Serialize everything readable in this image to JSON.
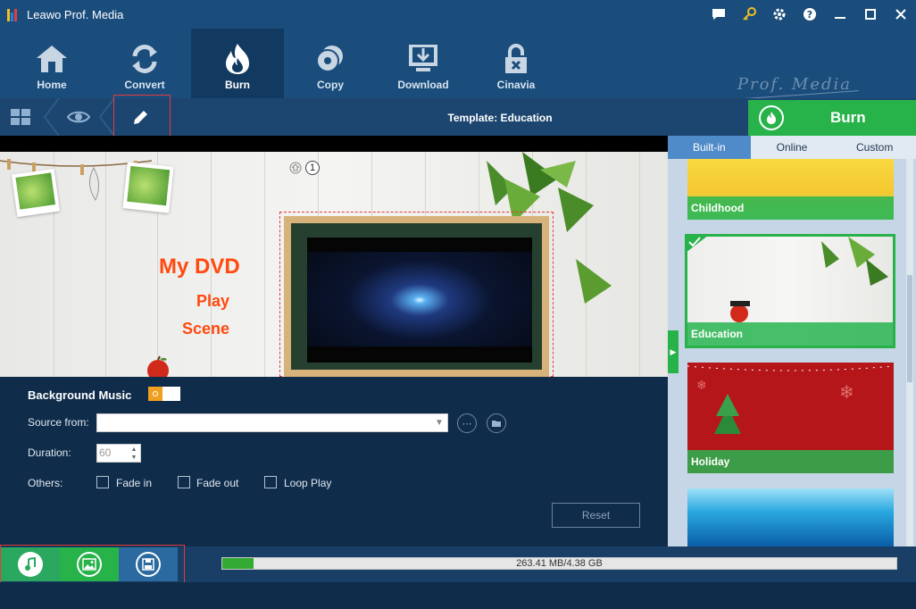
{
  "app": {
    "title": "Leawo Prof. Media",
    "brand": "Prof. Media"
  },
  "toolbar": {
    "items": [
      {
        "label": "Home",
        "icon": "home-icon"
      },
      {
        "label": "Convert",
        "icon": "convert-icon"
      },
      {
        "label": "Burn",
        "icon": "burn-icon",
        "active": true
      },
      {
        "label": "Copy",
        "icon": "copy-icon"
      },
      {
        "label": "Download",
        "icon": "download-icon"
      },
      {
        "label": "Cinavia",
        "icon": "cinavia-icon"
      }
    ]
  },
  "subbar": {
    "template_title": "Template: Education",
    "burn_label": "Burn"
  },
  "preview": {
    "menu_title": "My DVD",
    "menu_play": "Play",
    "menu_scene": "Scene",
    "page_number": "1"
  },
  "music": {
    "title": "Background Music",
    "source_label": "Source from:",
    "source_value": "",
    "duration_label": "Duration:",
    "duration_value": "60",
    "others_label": "Others:",
    "fade_in": "Fade in",
    "fade_out": "Fade out",
    "loop_play": "Loop Play",
    "reset": "Reset",
    "toggle_on": true
  },
  "templates": {
    "tabs": [
      {
        "label": "Built-in",
        "active": true
      },
      {
        "label": "Online"
      },
      {
        "label": "Custom"
      }
    ],
    "items": [
      {
        "label": "Childhood"
      },
      {
        "label": "Education",
        "selected": true
      },
      {
        "label": "Holiday"
      },
      {
        "label": ""
      }
    ]
  },
  "storage": {
    "text": "263.41 MB/4.38 GB",
    "fill_fraction": 0.046
  },
  "colors": {
    "accent": "#27b24a",
    "toolbar": "#1a4d7c",
    "menu_text": "#ff4a10"
  }
}
